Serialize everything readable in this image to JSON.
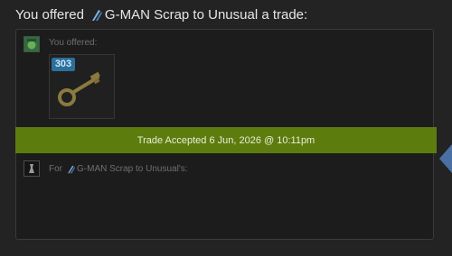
{
  "heading": {
    "prefix": "You offered",
    "item_name": "G-MAN Scrap to Unusual",
    "suffix": " a trade:"
  },
  "offer": {
    "label": "You offered:",
    "item": {
      "quantity_badge": "303",
      "icon": "key-icon"
    }
  },
  "banner": {
    "text": "Trade Accepted 6 Jun, 2026 @ 10:11pm",
    "color": "#5d7c0e"
  },
  "for_section": {
    "prefix": "For",
    "item_name": "G-MAN Scrap to Unusual",
    "suffix": "'s:"
  },
  "colors": {
    "background": "#232323",
    "panel": "#1c1c1c",
    "badge": "#2b6f9c",
    "side_arrow": "#4a6fa5"
  }
}
